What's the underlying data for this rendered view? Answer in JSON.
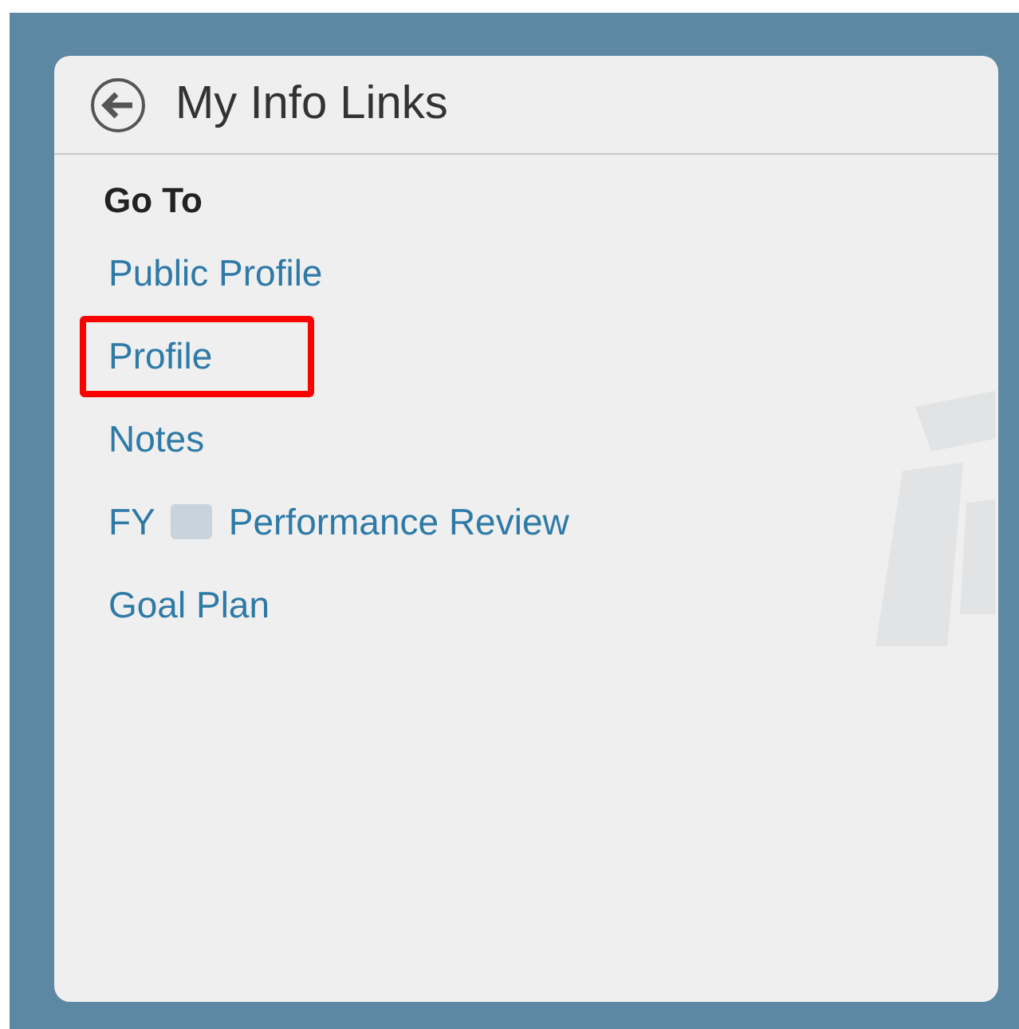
{
  "panel": {
    "title": "My Info Links"
  },
  "section_heading": "Go To",
  "links": [
    {
      "segments": [
        {
          "kind": "text",
          "text": "Public Profile"
        }
      ],
      "highlighted": false
    },
    {
      "segments": [
        {
          "kind": "text",
          "text": "Profile"
        }
      ],
      "highlighted": true
    },
    {
      "segments": [
        {
          "kind": "text",
          "text": "Notes"
        }
      ],
      "highlighted": false
    },
    {
      "segments": [
        {
          "kind": "text",
          "text": "FY"
        },
        {
          "kind": "redacted"
        },
        {
          "kind": "text",
          "text": "Performance Review"
        }
      ],
      "highlighted": false
    },
    {
      "segments": [
        {
          "kind": "text",
          "text": "Goal Plan"
        }
      ],
      "highlighted": false
    }
  ]
}
